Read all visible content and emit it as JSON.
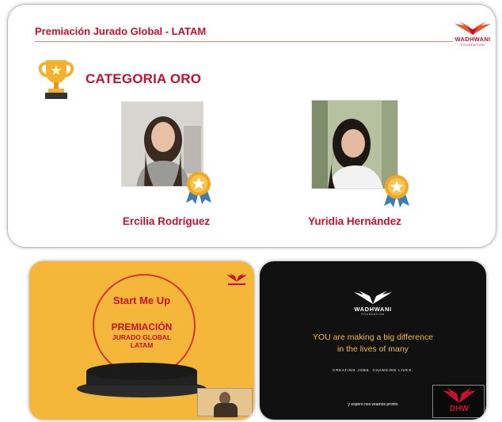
{
  "top_slide": {
    "title": "Premiación Jurado Global - LATAM",
    "logo_text": "WADHWANI",
    "logo_sub": "FOUNDATION",
    "category": "CATEGORIA ORO",
    "winners": [
      {
        "name": "Ercilia Rodríguez"
      },
      {
        "name": "Yuridia Hernández"
      }
    ],
    "colors": {
      "accent": "#c8102e",
      "gold": "#f2b230"
    },
    "icons": [
      "trophy-icon",
      "medal-icon"
    ]
  },
  "tile_left": {
    "brand": "Start Me Up",
    "title": "PREMIACIÓN",
    "line2": "JURADO GLOBAL",
    "line3": "LATAM"
  },
  "tile_right": {
    "logo_text": "WADHWANI",
    "logo_sub": "FOUNDATION",
    "message_line1": "YOU are making a big difference",
    "message_line2": "in the lives of many",
    "tagline": "CREATING JOBS. CHANGING LIVES.",
    "caption": "y espero nos veamos pronto",
    "corner_label": "DHW"
  }
}
